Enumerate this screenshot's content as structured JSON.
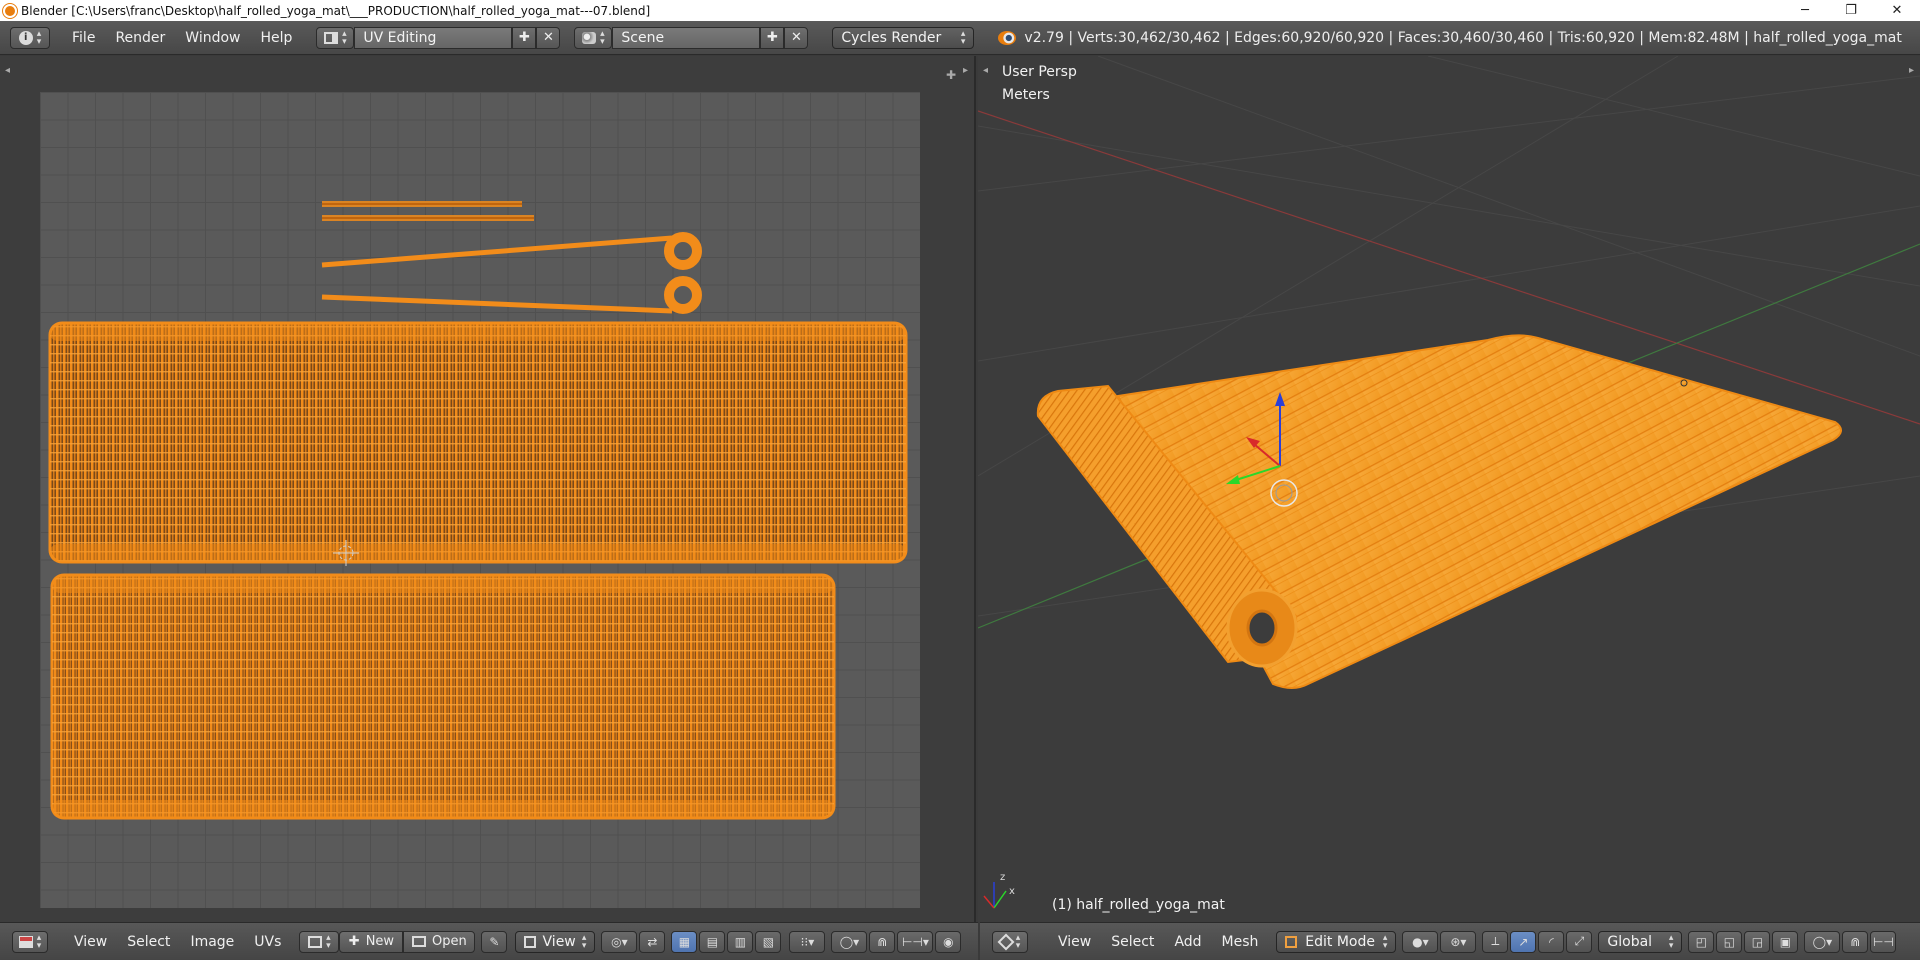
{
  "window": {
    "title": "Blender [C:\\Users\\franc\\Desktop\\half_rolled_yoga_mat\\___PRODUCTION\\half_rolled_yoga_mat---07.blend]",
    "controls": [
      "─",
      "❐",
      "✕"
    ]
  },
  "info_header": {
    "menus": [
      "File",
      "Render",
      "Window",
      "Help"
    ],
    "screen_layout": "UV Editing",
    "scene": "Scene",
    "render_engine": "Cycles Render",
    "stats": "v2.79 | Verts:30,462/30,462 | Edges:60,920/60,920 | Faces:30,460/30,460 | Tris:60,920 | Mem:82.48M | half_rolled_yoga_mat"
  },
  "uv_editor": {
    "menus": [
      "View",
      "Select",
      "Image",
      "UVs"
    ],
    "new_label": "New",
    "open_label": "Open",
    "view_label": "View"
  },
  "viewport": {
    "view_name": "User Persp",
    "units": "Meters",
    "object_label": "(1) half_rolled_yoga_mat",
    "menus": [
      "View",
      "Select",
      "Add",
      "Mesh"
    ],
    "mode": "Edit Mode",
    "orientation": "Global",
    "axis_x": "x",
    "axis_z": "z"
  },
  "colors": {
    "selected_wire": "#f08a16",
    "selected_face": "#f6a12a",
    "background": "#3c3c3c",
    "uv_grid": "#5a5a5a"
  }
}
